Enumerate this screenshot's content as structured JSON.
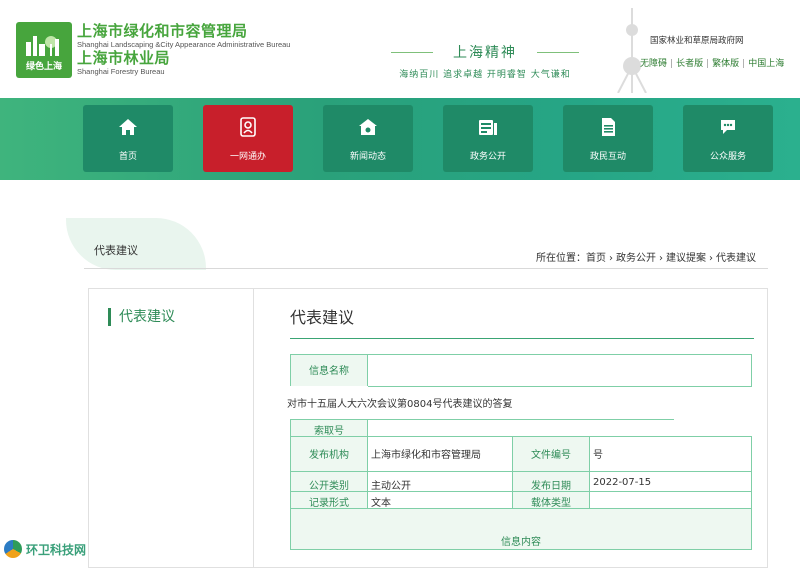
{
  "header": {
    "logo_text": "绿色上海",
    "org1_cn": "上海市绿化和市容管理局",
    "org1_en": "Shanghai Landscaping &City Appearance Administrative Bureau",
    "org2_cn": "上海市林业局",
    "org2_en": "Shanghai Forestry Bureau",
    "slogan_title": "上海精神",
    "slogan_sub": "海纳百川 追求卓越 开明睿智 大气谦和",
    "top_link_title": "国家林业和草原局政府网",
    "top_links": [
      "无障碍",
      "长者版",
      "繁体版",
      "中国上海"
    ]
  },
  "nav": {
    "items": [
      {
        "label": "首页",
        "icon": "home-icon"
      },
      {
        "label": "一网通办",
        "icon": "service-icon"
      },
      {
        "label": "新闻动态",
        "icon": "news-icon"
      },
      {
        "label": "政务公开",
        "icon": "gov-open-icon"
      },
      {
        "label": "政民互动",
        "icon": "document-icon"
      },
      {
        "label": "公众服务",
        "icon": "chat-icon"
      }
    ],
    "active_color": "#c81f2b",
    "item_color": "#1f8a67"
  },
  "breadcrumb": {
    "section_title": "代表建议",
    "prefix": "所在位置：",
    "items": [
      "首页",
      "政务公开",
      "建议提案",
      "代表建议"
    ]
  },
  "sidebar": {
    "title": "代表建议"
  },
  "main": {
    "title": "代表建议",
    "info": {
      "name_label": "信息名称",
      "name_value": "对市十五届人大六次会议第0804号代表建议的答复",
      "index_label": "索取号",
      "index_value": "",
      "publisher_label": "发布机构",
      "publisher_value": "上海市绿化和市容管理局",
      "doc_no_label": "文件编号",
      "doc_no_value": "号",
      "open_type_label": "公开类别",
      "open_type_value": "主动公开",
      "date_label": "发布日期",
      "date_value": "2022-07-15",
      "record_form_label": "记录形式",
      "record_form_value": "文本",
      "carrier_label": "载体类型",
      "carrier_value": "",
      "content_label": "信息内容"
    }
  },
  "watermark": {
    "text": "环卫科技网"
  }
}
